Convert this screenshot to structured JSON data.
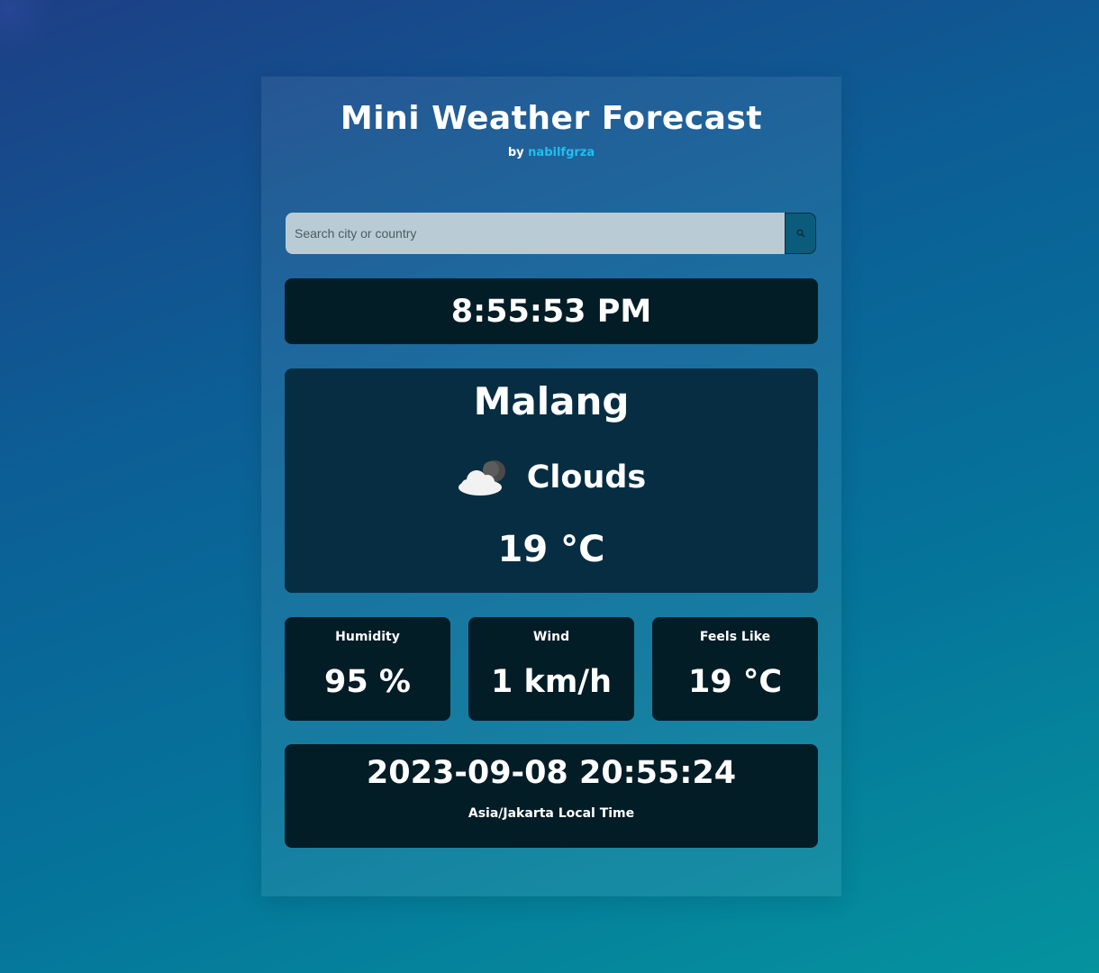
{
  "header": {
    "title": "Mini Weather Forecast",
    "by_prefix": "by",
    "author": "nabilfgrza"
  },
  "search": {
    "placeholder": "Search city or country",
    "value": "",
    "button_icon": "search-icon"
  },
  "clock": {
    "time": "8:55:53 PM"
  },
  "weather": {
    "city": "Malang",
    "condition": "Clouds",
    "condition_icon": "cloud-night-icon",
    "temperature": "19 °C"
  },
  "stats": [
    {
      "label": "Humidity",
      "value": "95 %"
    },
    {
      "label": "Wind",
      "value": "1 km/h"
    },
    {
      "label": "Feels Like",
      "value": "19 °C"
    }
  ],
  "local_time": {
    "datetime": "2023-09-08 20:55:24",
    "timezone_label": "Asia/Jakarta Local Time"
  },
  "colors": {
    "accent": "#1ec0f0",
    "panel_dark": "#031d27",
    "panel_main": "#062d42"
  }
}
